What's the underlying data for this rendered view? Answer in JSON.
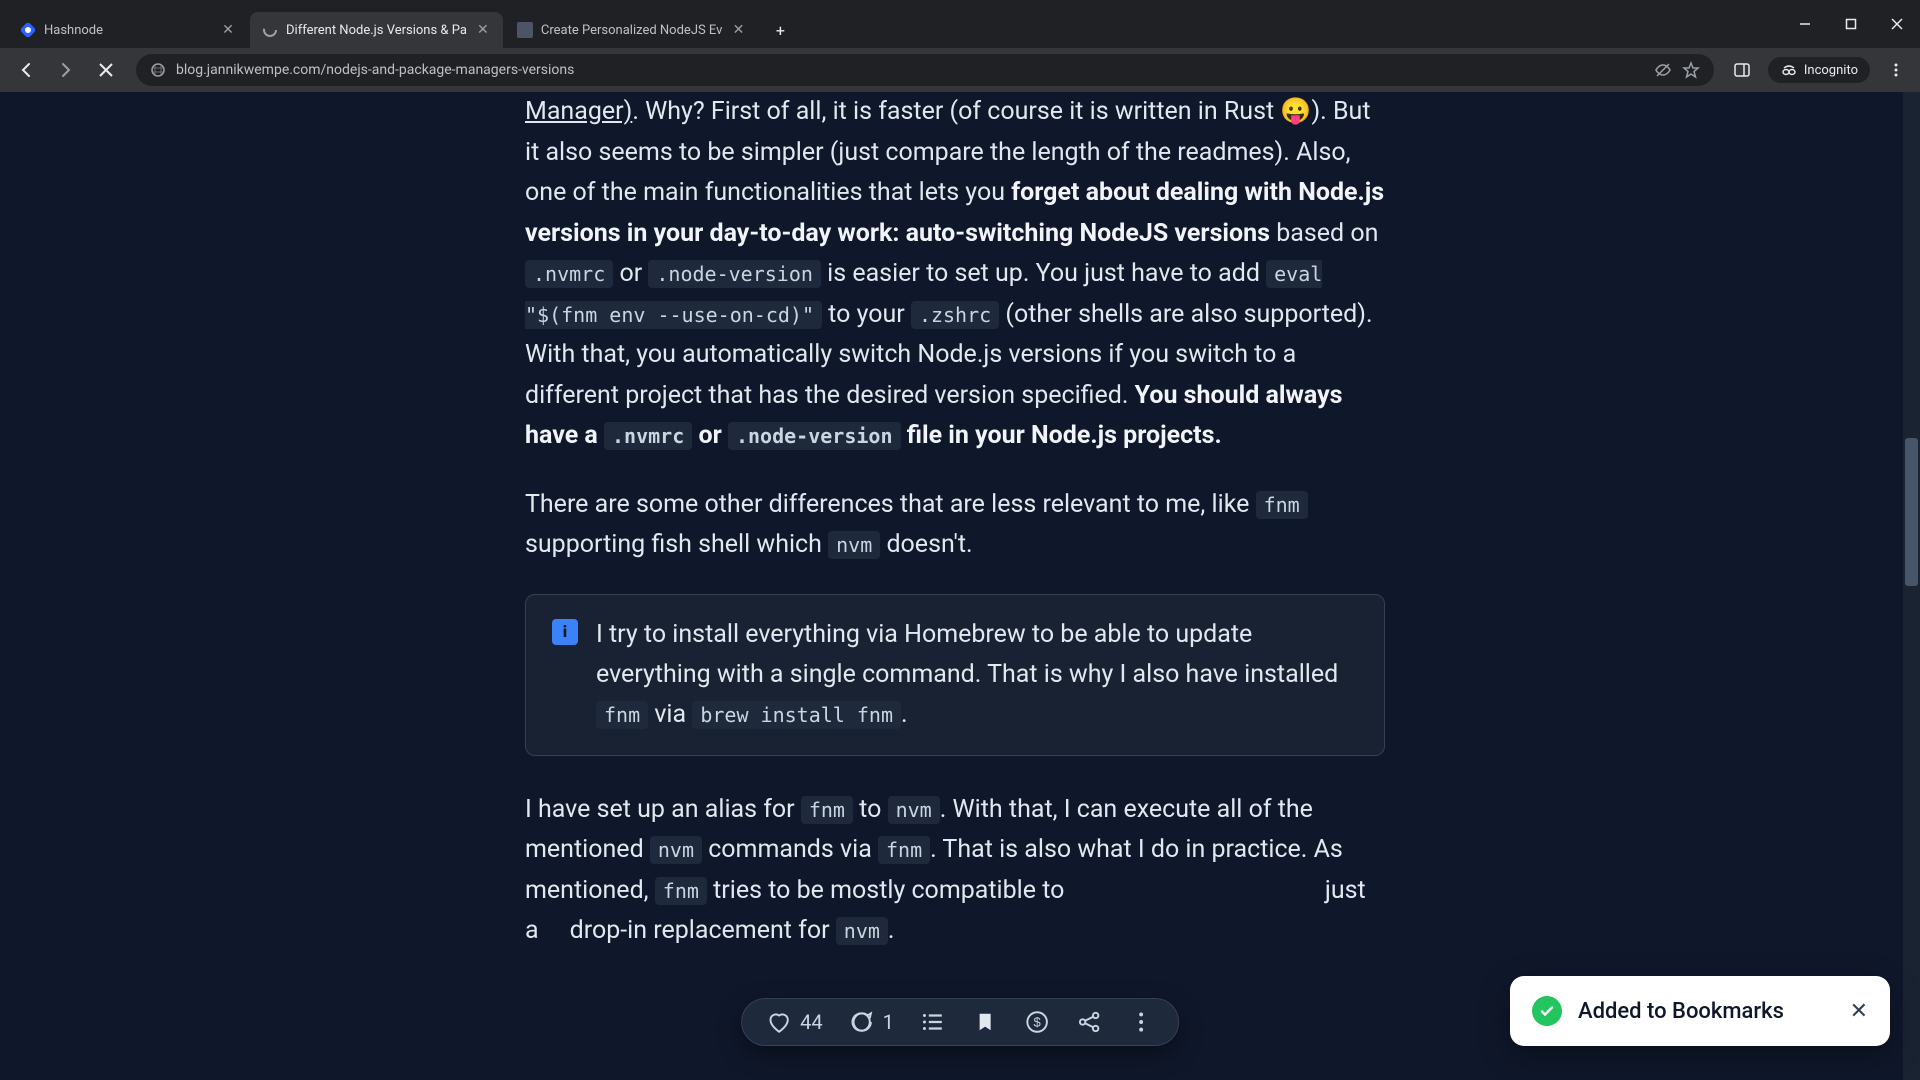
{
  "browser": {
    "tabs": [
      {
        "title": "Hashnode"
      },
      {
        "title": "Different Node.js Versions & Pa"
      },
      {
        "title": "Create Personalized NodeJS Ev"
      }
    ],
    "url": "blog.jannikwempe.com/nodejs-and-package-managers-versions",
    "incognito_label": "Incognito"
  },
  "article": {
    "p1_link": "Manager)",
    "p1_a": ". Why? First of all, it is faster (of course it is written in Rust 😛). But it also seems to be simpler (just compare the length of the readmes). Also, one of the main functionalities that lets you ",
    "p1_b_strong": "forget about dealing with Node.js versions in your day-to-day work: auto-switching NodeJS versions",
    "p1_c": " based on ",
    "p1_code1": ".nvmrc",
    "p1_d": " or ",
    "p1_code2": ".node-version",
    "p1_e": " is easier to set up. You just have to add ",
    "p1_code3": "eval \"$(fnm env --use-on-cd)\"",
    "p1_f": " to your ",
    "p1_code4": ".zshrc",
    "p1_g": " (other shells are also supported). With that, you automatically switch Node.js versions if you switch to a different project that has the desired version specified. ",
    "p1_h_strong": "You should always have a ",
    "p1_code5": ".nvmrc",
    "p1_i_strong": " or ",
    "p1_code6": ".node-version",
    "p1_j_strong": " file in your Node.js projects.",
    "p2_a": "There are some other differences that are less relevant to me, like ",
    "p2_code1": "fnm",
    "p2_b": " supporting fish shell which ",
    "p2_code2": "nvm",
    "p2_c": " doesn't.",
    "callout_a": "I try to install everything via Homebrew to be able to update everything with a single command. That is why I also have installed ",
    "callout_code1": "fnm",
    "callout_b": " via ",
    "callout_code2": "brew install fnm",
    "callout_c": ".",
    "p3_a": "I have set up an alias for ",
    "p3_code1": "fnm",
    "p3_b": " to ",
    "p3_code2": "nvm",
    "p3_c": ". With that, I can execute all of the mentioned ",
    "p3_code3": "nvm",
    "p3_d": " commands via ",
    "p3_code4": "fnm",
    "p3_e": ". That is also what I do in practice. As mentioned, ",
    "p3_code5": "fnm",
    "p3_f": " tries to be mostly compatible to",
    "p3_g": "just a",
    "p3_h": "drop-in replacement for ",
    "p3_code6": "nvm",
    "p3_i": "."
  },
  "actions": {
    "likes": "44",
    "comments": "1"
  },
  "toast": {
    "text": "Added to Bookmarks"
  }
}
